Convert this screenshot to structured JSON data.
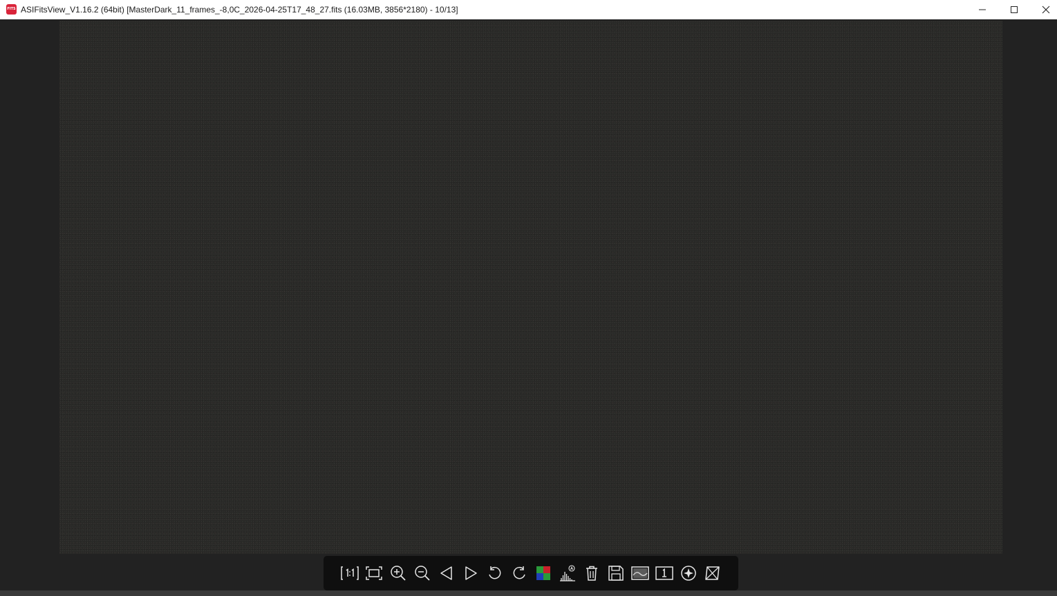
{
  "window": {
    "title": "ASIFitsView_V1.16.2 (64bit) [MasterDark_11_frames_-8,0C_2026-04-25T17_48_27.fits (16.03MB, 3856*2180) - 10/13]",
    "app_icon_text": "FITS",
    "accent": "#d9243a"
  },
  "controls": {
    "minimize": "minimize-icon",
    "maximize": "maximize-icon",
    "close": "close-icon"
  },
  "viewer": {
    "background": "#222222",
    "image_background": "#292927"
  },
  "toolbar": {
    "tools": [
      {
        "name": "actual-size-icon"
      },
      {
        "name": "fit-window-icon"
      },
      {
        "name": "zoom-in-icon"
      },
      {
        "name": "zoom-out-icon"
      },
      {
        "name": "previous-icon"
      },
      {
        "name": "next-icon"
      },
      {
        "name": "rotate-left-icon"
      },
      {
        "name": "rotate-right-icon"
      },
      {
        "name": "debayer-icon"
      },
      {
        "name": "auto-stretch-histogram-icon"
      },
      {
        "name": "delete-icon"
      },
      {
        "name": "save-icon"
      },
      {
        "name": "image-preview-icon"
      },
      {
        "name": "single-frame-icon"
      },
      {
        "name": "star-detect-icon"
      },
      {
        "name": "flip-icon"
      }
    ]
  }
}
